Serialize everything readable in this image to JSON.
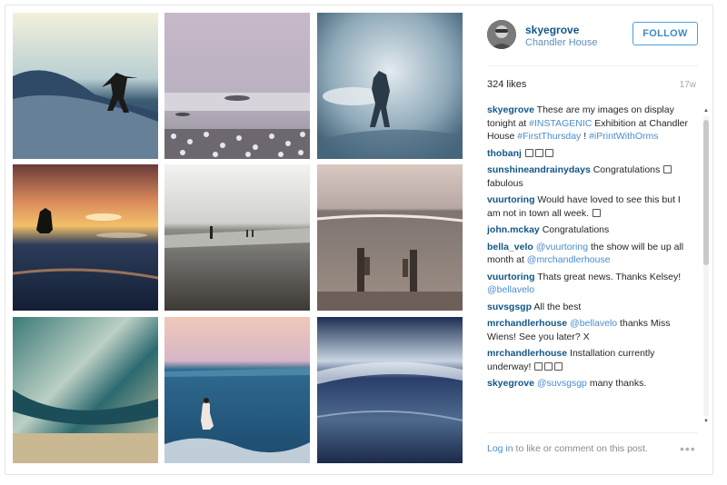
{
  "header": {
    "username": "skyegrove",
    "location": "Chandler House",
    "follow_label": "FOLLOW"
  },
  "stats": {
    "likes": "324 likes",
    "age": "17w"
  },
  "comments": [
    {
      "user": "skyegrove",
      "parts": [
        {
          "t": " These are my images on display tonight at "
        },
        {
          "t": "#INSTAGENIC",
          "k": "tag"
        },
        {
          "t": " Exhibition at Chandler House "
        },
        {
          "t": "#FirstThursday",
          "k": "tag"
        },
        {
          "t": " ! "
        },
        {
          "t": "#iPrintWithOrms",
          "k": "tag"
        }
      ]
    },
    {
      "user": "thobanj",
      "emoji": 3,
      "parts": [
        {
          "t": " "
        }
      ]
    },
    {
      "user": "sunshineandrainydays",
      "emoji_after_user": 1,
      "parts": [
        {
          "t": " Congratulations "
        },
        {
          "t": "fabulous"
        }
      ]
    },
    {
      "user": "vuurtoring",
      "emoji_end": 1,
      "parts": [
        {
          "t": " Would have loved to see this but I am not in town all week. "
        }
      ]
    },
    {
      "user": "john.mckay",
      "parts": [
        {
          "t": " Congratulations"
        }
      ]
    },
    {
      "user": "bella_velo",
      "parts": [
        {
          "t": " "
        },
        {
          "t": "@vuurtoring",
          "k": "mention"
        },
        {
          "t": " the show will be up all month at "
        },
        {
          "t": "@mrchandlerhouse",
          "k": "mention"
        }
      ]
    },
    {
      "user": "vuurtoring",
      "parts": [
        {
          "t": " Thats great news. Thanks Kelsey! "
        },
        {
          "t": "@bellavelo",
          "k": "mention"
        }
      ]
    },
    {
      "user": "suvsgsgp",
      "parts": [
        {
          "t": " All the best"
        }
      ]
    },
    {
      "user": "mrchandlerhouse",
      "parts": [
        {
          "t": " "
        },
        {
          "t": "@bellavelo",
          "k": "mention"
        },
        {
          "t": " thanks Miss Wiens! See you later? X"
        }
      ]
    },
    {
      "user": "mrchandlerhouse",
      "emoji_end": 3,
      "parts": [
        {
          "t": " Installation currently underway! "
        }
      ]
    },
    {
      "user": "skyegrove",
      "parts": [
        {
          "t": " "
        },
        {
          "t": "@suvsgsgp",
          "k": "mention"
        },
        {
          "t": " many thanks."
        }
      ]
    }
  ],
  "footer": {
    "login_link": "Log in",
    "login_rest": " to like or comment on this post.",
    "more_icon": "ellipsis-icon",
    "more_glyph": "•••"
  },
  "colors": {
    "username": "#125688",
    "link": "#4a8cd0",
    "follow_border": "#4a9fe0"
  },
  "photos": [
    "surfer-on-wave",
    "pebble-beach",
    "surfer-in-spray",
    "sunset-paddler",
    "beach-walkers",
    "beach-posts",
    "teal-sky-sea",
    "girl-in-waves",
    "dark-blue-sea"
  ]
}
